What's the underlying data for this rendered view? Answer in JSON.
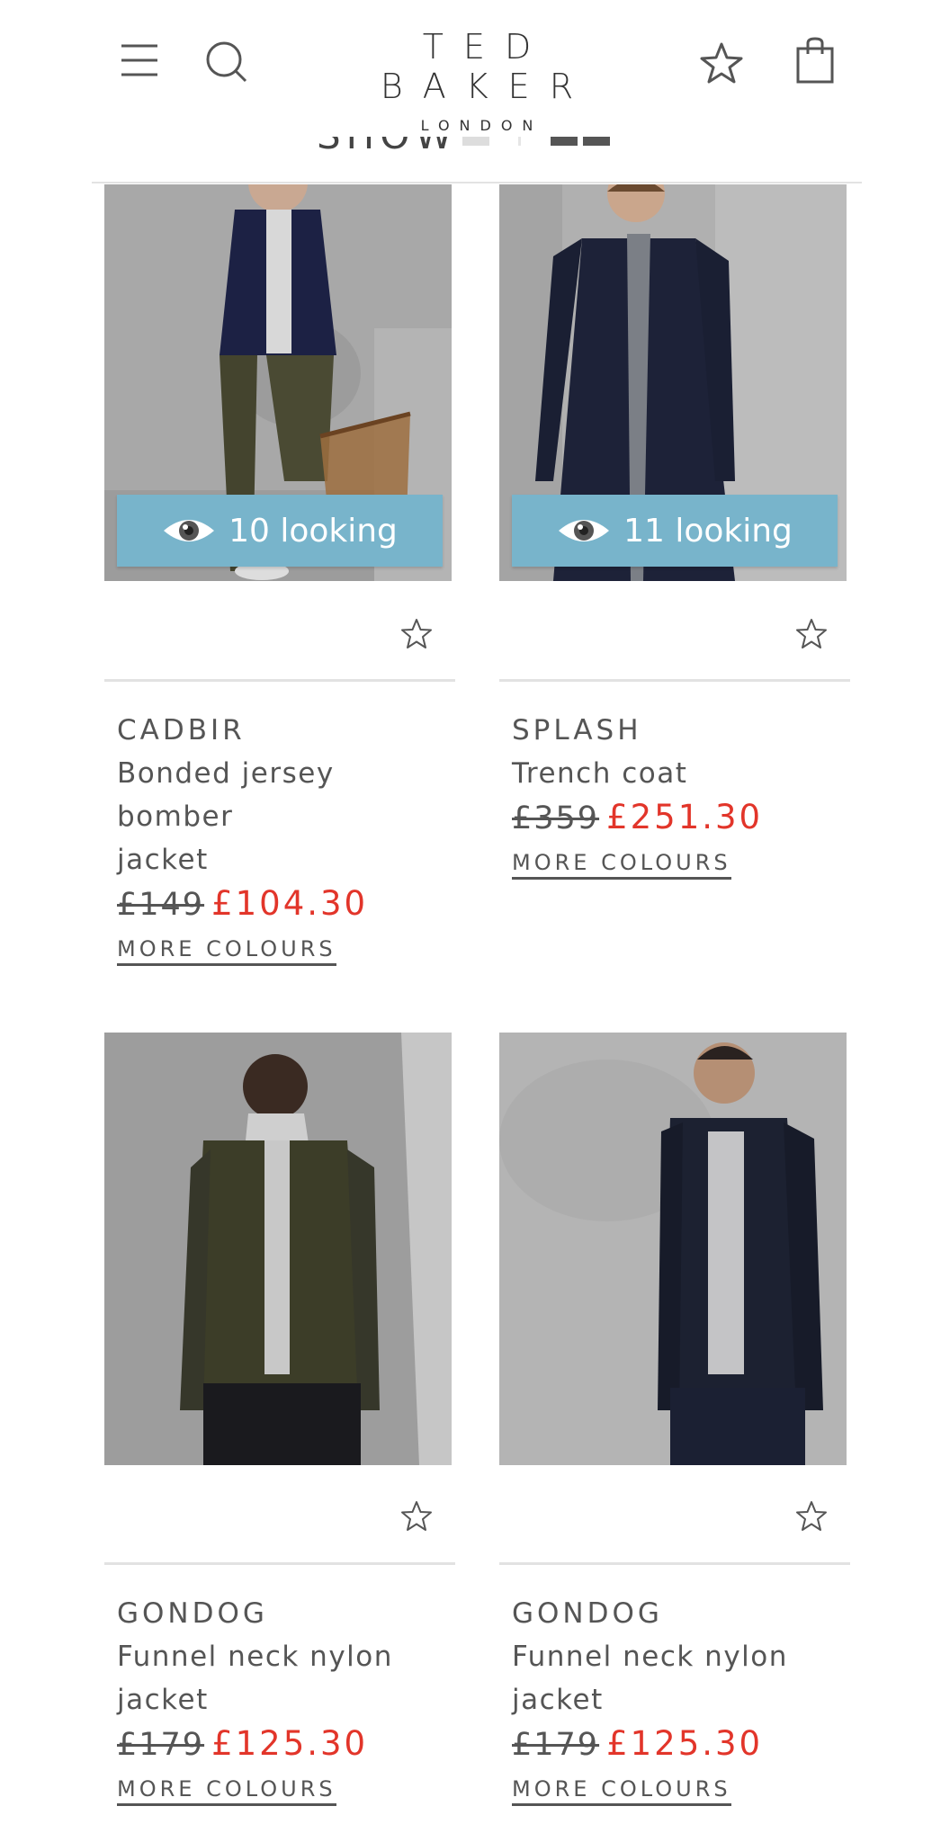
{
  "header": {
    "brand": "TED BAKER",
    "brand_sub": "LONDON",
    "icons": [
      "menu-icon",
      "search-icon",
      "wishlist-star-icon",
      "shopping-bag-icon"
    ]
  },
  "filter_bar": {
    "show_label": "SHOW"
  },
  "colors": {
    "sale": "#e2352a",
    "looking_badge": "#78b4cb",
    "text": "#555555"
  },
  "products": [
    {
      "brand": "CADBIR",
      "title_line1": "Bonded jersey bomber",
      "title_line2": "jacket",
      "old_price": "£149",
      "new_price": "£104.30",
      "more_colours": "MORE COLOURS",
      "looking": "10 looking"
    },
    {
      "brand": "SPLASH",
      "title_line1": "Trench coat",
      "title_line2": "",
      "old_price": "£359",
      "new_price": "£251.30",
      "more_colours": "MORE COLOURS",
      "looking": "11 looking"
    },
    {
      "brand": "GONDOG",
      "title_line1": "Funnel neck nylon",
      "title_line2": "jacket",
      "old_price": "£179",
      "new_price": "£125.30",
      "more_colours": "MORE COLOURS"
    },
    {
      "brand": "GONDOG",
      "title_line1": "Funnel neck nylon",
      "title_line2": "jacket",
      "old_price": "£179",
      "new_price": "£125.30",
      "more_colours": "MORE COLOURS"
    }
  ]
}
